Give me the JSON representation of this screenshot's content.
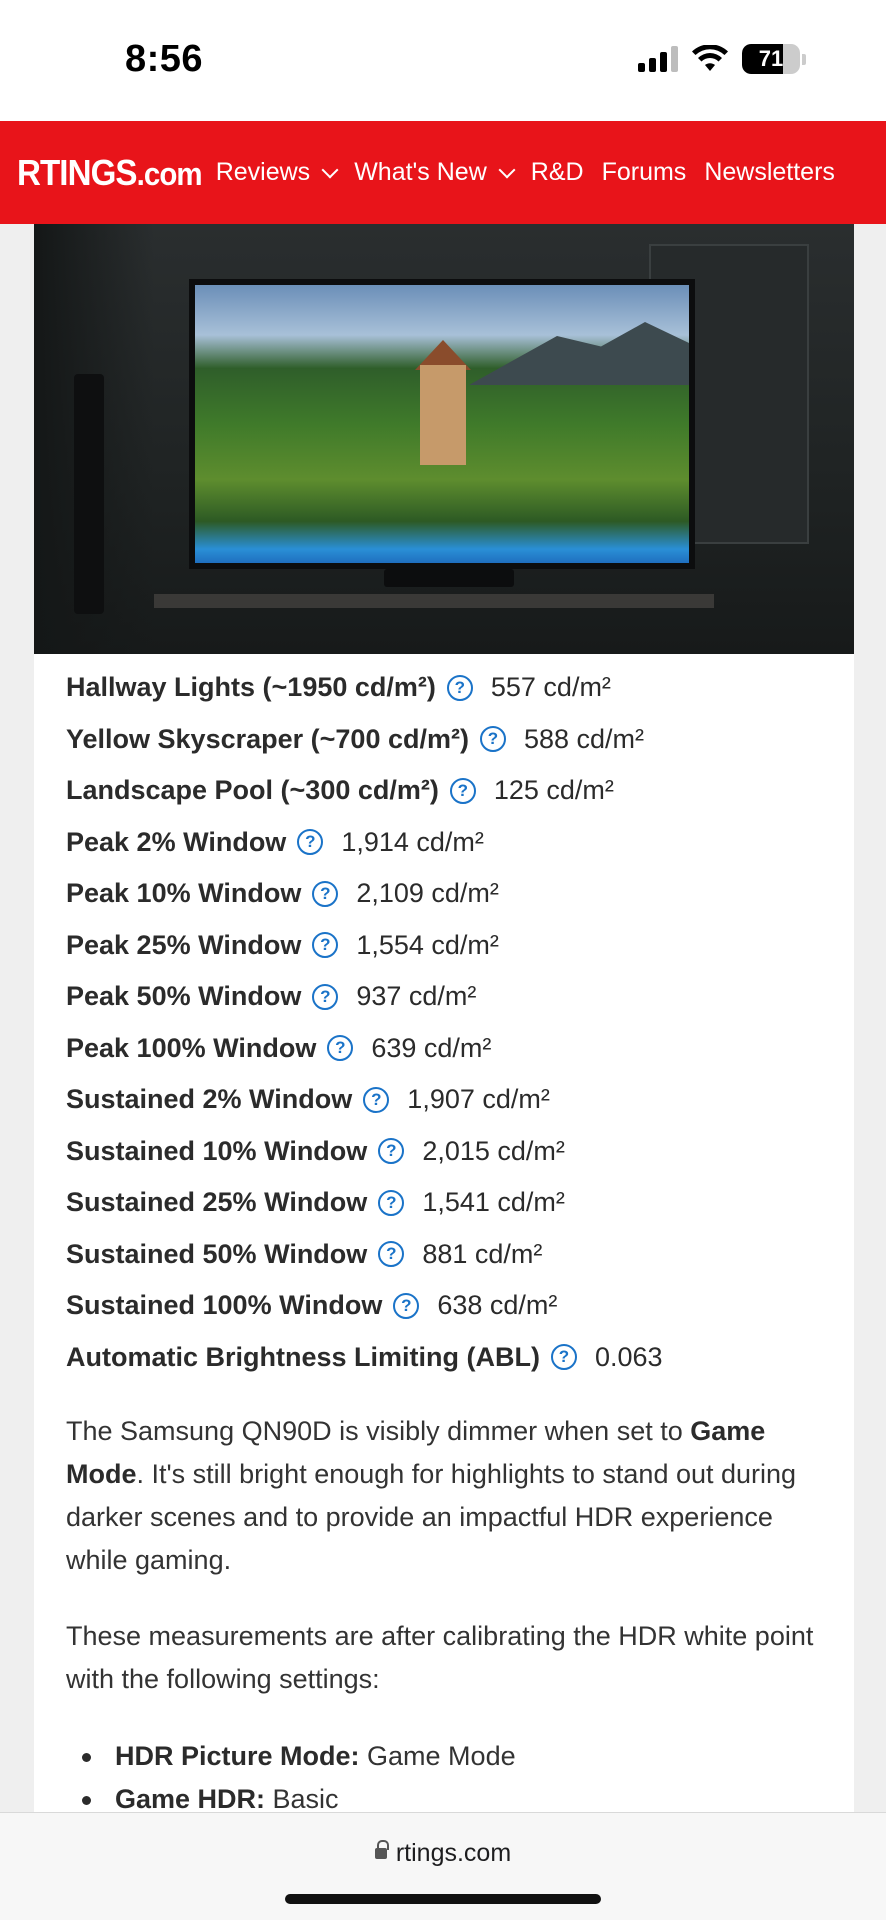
{
  "status_bar": {
    "time": "8:56",
    "battery": "71"
  },
  "nav": {
    "logo": "RTINGS",
    "logo_suffix": ".com",
    "items": [
      {
        "label": "Reviews"
      },
      {
        "label": "What's New"
      },
      {
        "label": "R&D"
      },
      {
        "label": "Forums"
      },
      {
        "label": "Newsletters"
      }
    ]
  },
  "specs": [
    {
      "label": "Hallway Lights (~1950 cd/m²)",
      "value": "557 cd/m²"
    },
    {
      "label": "Yellow Skyscraper (~700 cd/m²)",
      "value": "588 cd/m²"
    },
    {
      "label": "Landscape Pool (~300 cd/m²)",
      "value": "125 cd/m²"
    },
    {
      "label": "Peak 2% Window",
      "value": "1,914 cd/m²"
    },
    {
      "label": "Peak 10% Window",
      "value": "2,109 cd/m²"
    },
    {
      "label": "Peak 25% Window",
      "value": "1,554 cd/m²"
    },
    {
      "label": "Peak 50% Window",
      "value": "937 cd/m²"
    },
    {
      "label": "Peak 100% Window",
      "value": "639 cd/m²"
    },
    {
      "label": "Sustained 2% Window",
      "value": "1,907 cd/m²"
    },
    {
      "label": "Sustained 10% Window",
      "value": "2,015 cd/m²"
    },
    {
      "label": "Sustained 25% Window",
      "value": "1,541 cd/m²"
    },
    {
      "label": "Sustained 50% Window",
      "value": "881 cd/m²"
    },
    {
      "label": "Sustained 100% Window",
      "value": "638 cd/m²"
    },
    {
      "label": "Automatic Brightness Limiting (ABL)",
      "value": "0.063"
    }
  ],
  "help_icon": "?",
  "paragraph1": {
    "before": "The Samsung QN90D is visibly dimmer when set to ",
    "bold": "Game Mode",
    "after": ". It's still bright enough for highlights to stand out during darker scenes and to provide an impactful HDR experience while gaming."
  },
  "paragraph2": "These measurements are after calibrating the HDR white point with the following settings:",
  "bullets": [
    {
      "label": "HDR Picture Mode:",
      "value": " Game Mode"
    },
    {
      "label": "Game HDR:",
      "value": " Basic"
    }
  ],
  "url_bar": {
    "url": "rtings.com"
  },
  "colors": {
    "brand": "#e8141a",
    "link": "#1a73c8"
  }
}
